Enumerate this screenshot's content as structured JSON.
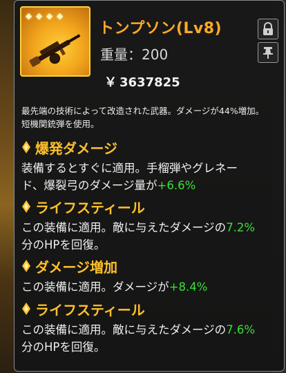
{
  "item": {
    "title": "トンプソン(Lv8)",
    "weight_label": "重量：",
    "weight_value": "200",
    "price_symbol": "￥",
    "price_value": "3637825",
    "rarity_stars": 4,
    "icon": "tommy-gun-icon",
    "description_line1": "最先端の技術によって改造された武器。ダメージが44%増加。",
    "description_line2": "短機関銃弾を使用。"
  },
  "colors": {
    "title": "#ffa928",
    "section_heading": "#ffc02a",
    "highlight": "#38e038",
    "frame": "#ffd23a"
  },
  "buttons": {
    "lock_icon": "lock-icon",
    "pin_icon": "pin-icon"
  },
  "effects": [
    {
      "heading": "爆発ダメージ",
      "line1": "装備するとすぐに適用。手榴弾やグレネー",
      "line2_pre": "ド、爆裂弓のダメージ量が",
      "line2_value": "+6.6%",
      "line2_post": ""
    },
    {
      "heading": "ライフスティール",
      "line1_pre": "この装備に適用。敵に与えたダメージの",
      "line1_value": "7.2%",
      "line2": "分のHPを回復。"
    },
    {
      "heading": "ダメージ増加",
      "line1_pre": "この装備に適用。ダメージが",
      "line1_value": "+8.4%"
    },
    {
      "heading": "ライフスティール",
      "line1_pre": "この装備に適用。敵に与えたダメージの",
      "line1_value": "7.6%",
      "line2": "分のHPを回復。"
    }
  ]
}
